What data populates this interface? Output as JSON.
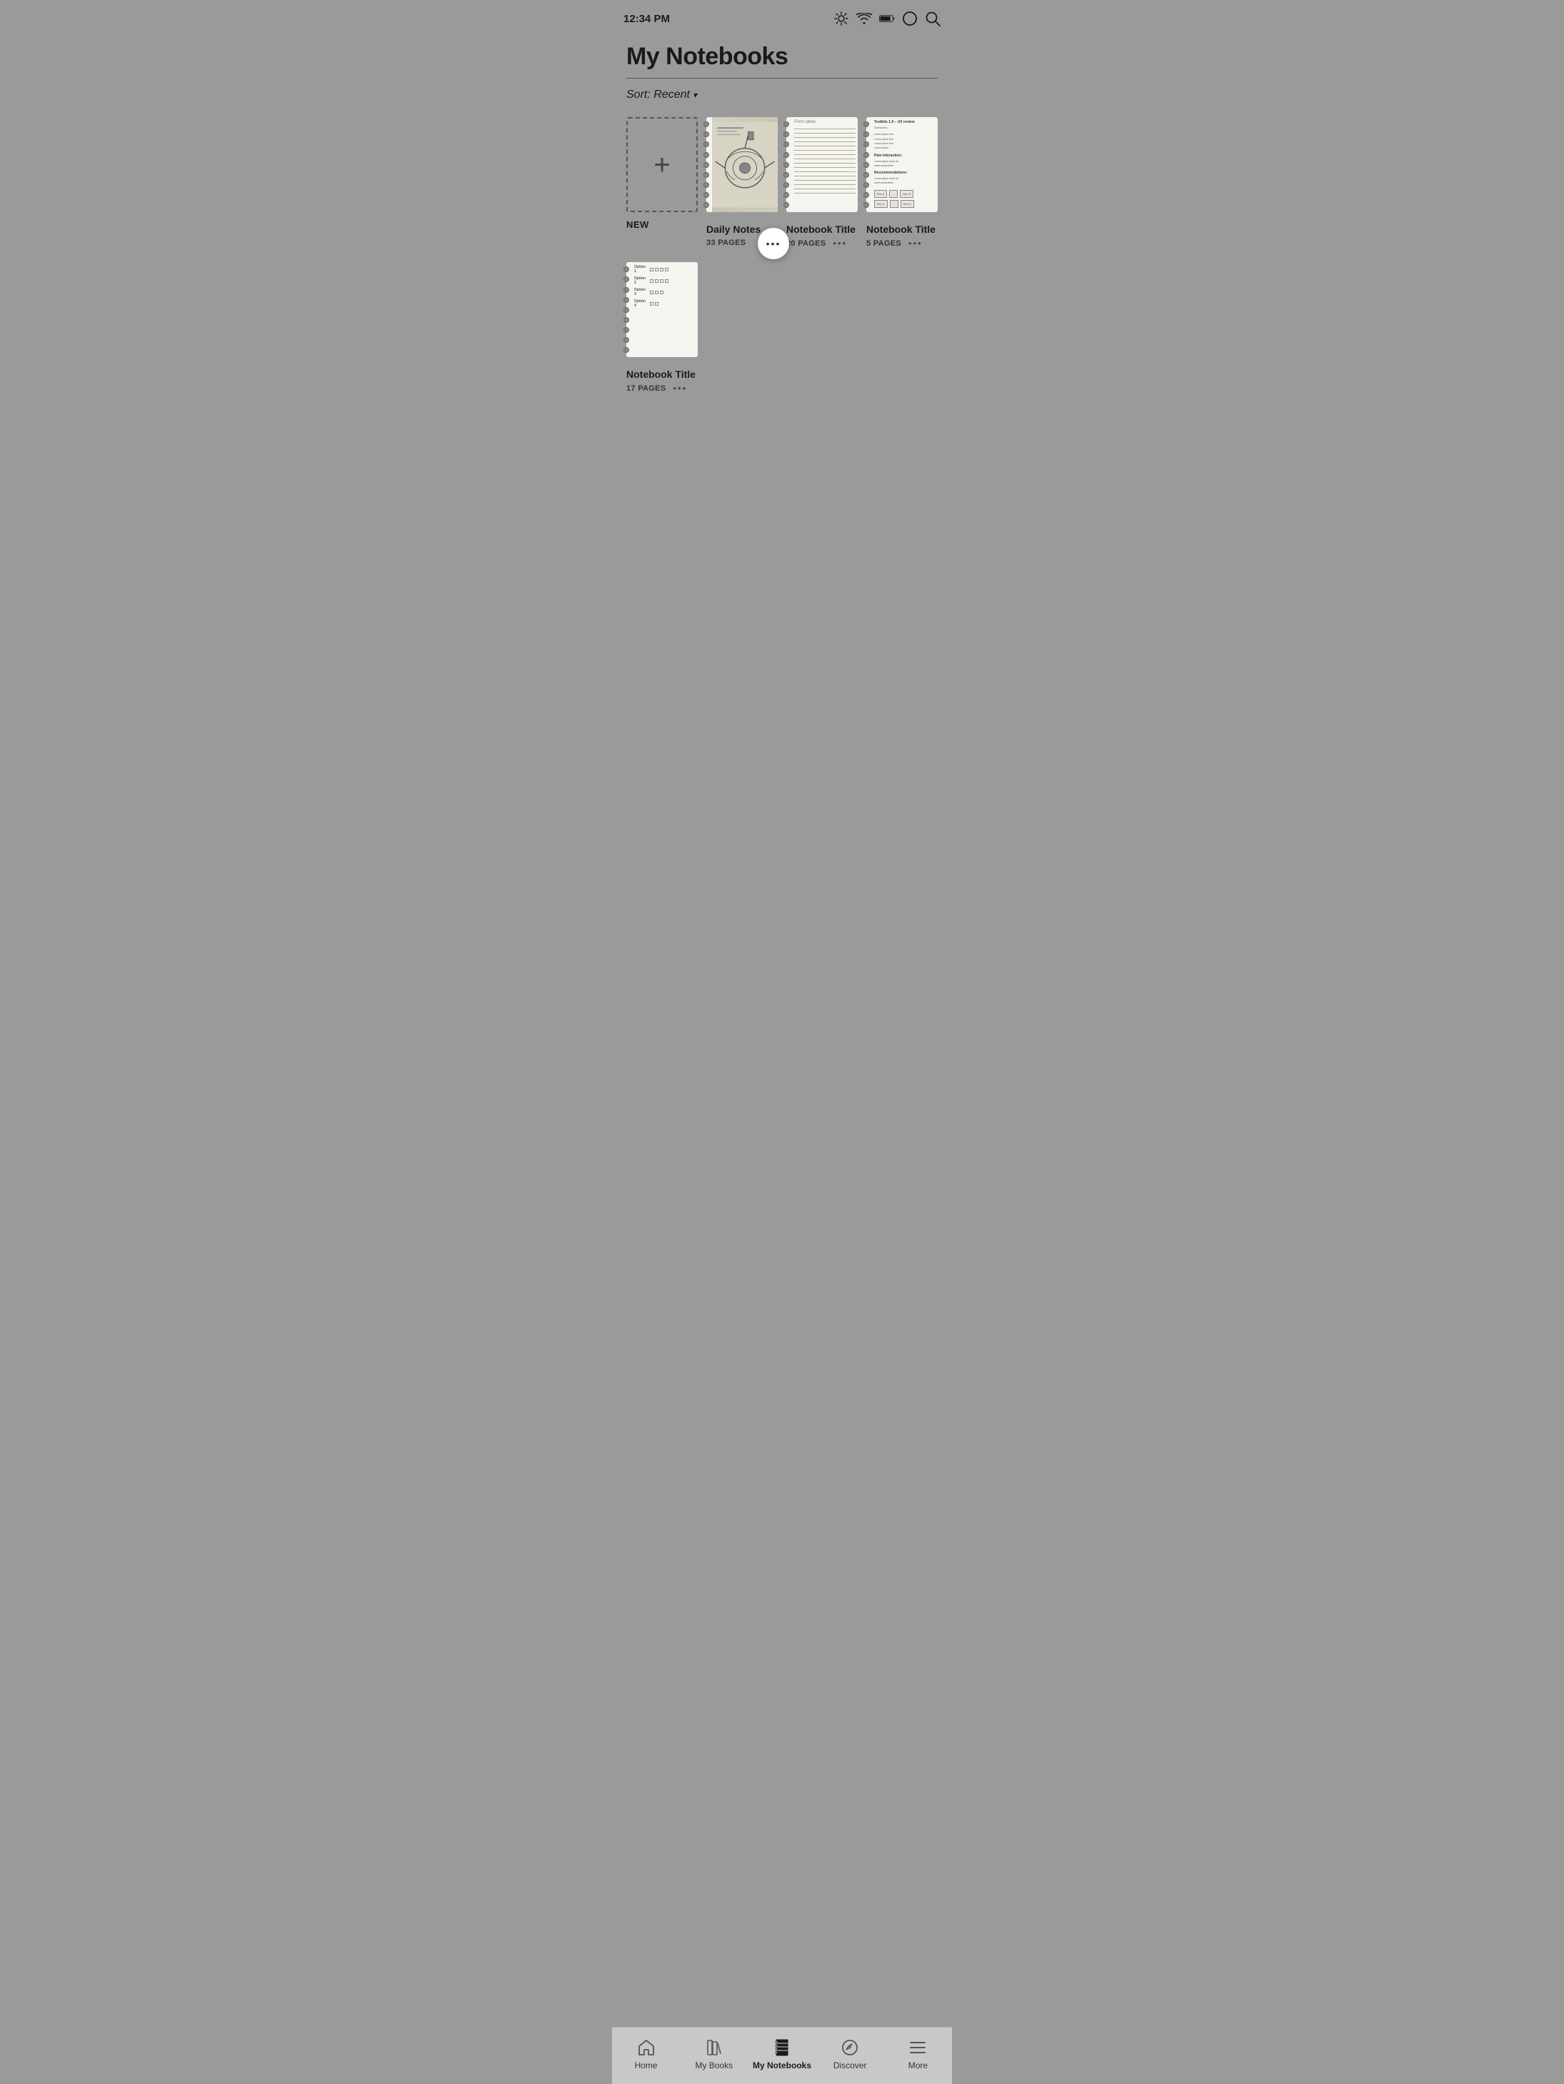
{
  "status_bar": {
    "time": "12:34 PM"
  },
  "header": {
    "title": "My Notebooks"
  },
  "sort": {
    "label": "Sort: Recent",
    "chevron": "▾"
  },
  "notebooks": [
    {
      "id": "new",
      "type": "new",
      "label": "NEW"
    },
    {
      "id": "nb1",
      "type": "notebook",
      "title": "Daily Notes",
      "pages": "33 PAGES",
      "has_more": true,
      "more_label": "•••",
      "active_more": true
    },
    {
      "id": "nb2",
      "type": "notebook",
      "title": "Notebook Title",
      "pages": "20 PAGES",
      "has_more": true,
      "more_label": "•••"
    },
    {
      "id": "nb3",
      "type": "notebook",
      "title": "Notebook Title",
      "pages": "5 PAGES",
      "has_more": true,
      "more_label": "•••"
    },
    {
      "id": "nb4",
      "type": "notebook",
      "title": "Notebook Title",
      "pages": "17 PAGES",
      "has_more": true,
      "more_label": "•••"
    }
  ],
  "nav": {
    "items": [
      {
        "id": "home",
        "label": "Home",
        "active": false
      },
      {
        "id": "my-books",
        "label": "My Books",
        "active": false
      },
      {
        "id": "my-notebooks",
        "label": "My Notebooks",
        "active": true
      },
      {
        "id": "discover",
        "label": "Discover",
        "active": false
      },
      {
        "id": "more",
        "label": "More",
        "active": false
      }
    ]
  }
}
